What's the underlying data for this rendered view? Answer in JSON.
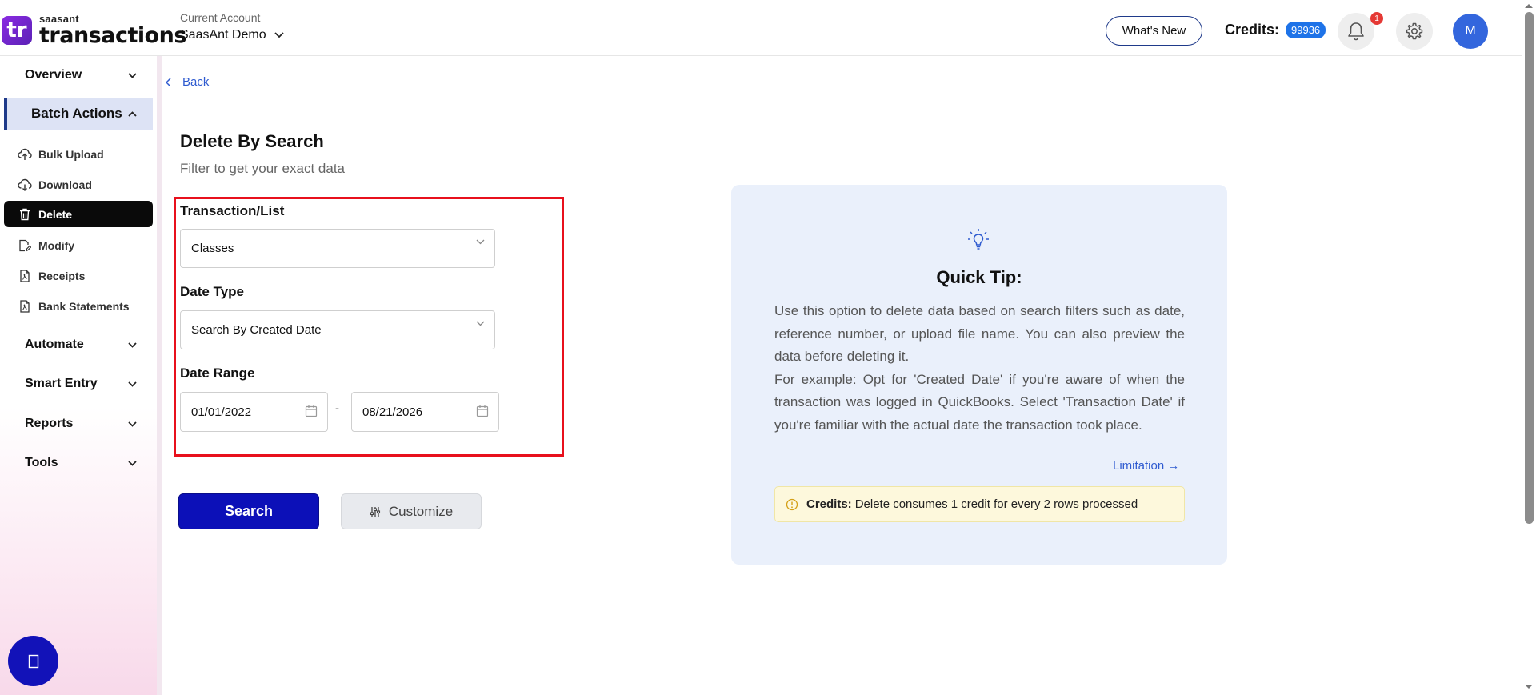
{
  "header": {
    "logo_small": "saasant",
    "logo_big": "transactions",
    "logo_badge": "tr",
    "account_label": "Current Account",
    "account_value": "SaasAnt Demo",
    "whats_new": "What's New",
    "credits_label": "Credits:",
    "credits_value": "99936",
    "notification_count": "1",
    "avatar_initial": "M"
  },
  "sidebar": {
    "groups": [
      {
        "label": "Overview"
      },
      {
        "label": "Batch Actions"
      },
      {
        "label": "Automate"
      },
      {
        "label": "Smart Entry"
      },
      {
        "label": "Reports"
      },
      {
        "label": "Tools"
      }
    ],
    "items": [
      {
        "label": "Bulk Upload"
      },
      {
        "label": "Download"
      },
      {
        "label": "Delete"
      },
      {
        "label": "Modify"
      },
      {
        "label": "Receipts"
      },
      {
        "label": "Bank Statements"
      }
    ],
    "help_icon": "chat-icon"
  },
  "main": {
    "back": "Back",
    "title": "Delete By Search",
    "subtitle": "Filter to get your exact data",
    "transaction_label": "Transaction/List",
    "transaction_value": "Classes",
    "date_type_label": "Date Type",
    "date_type_value": "Search By Created Date",
    "date_range_label": "Date Range",
    "date_from": "01/01/2022",
    "date_separator": "-",
    "date_to": "08/21/2026",
    "search_button": "Search",
    "customize_button": "Customize"
  },
  "tip": {
    "title": "Quick Tip:",
    "paragraph1": "Use this option to delete data based on search filters such as date, reference number, or upload file name. You can also preview the data before deleting it.",
    "paragraph2": "For example: Opt for 'Created Date' if you're aware of when the transaction was logged in QuickBooks. Select 'Transaction Date' if you're familiar with the actual date the transaction took place.",
    "limitation": "Limitation →",
    "credits_label": "Credits:",
    "credits_text": "Delete consumes 1 credit for every 2 rows processed"
  },
  "colors": {
    "primary": "#0c10b8",
    "link": "#2f5bd0",
    "highlight": "#e8101c",
    "credits_badge": "#1e73e8",
    "tip_background": "#eaf0fb"
  }
}
